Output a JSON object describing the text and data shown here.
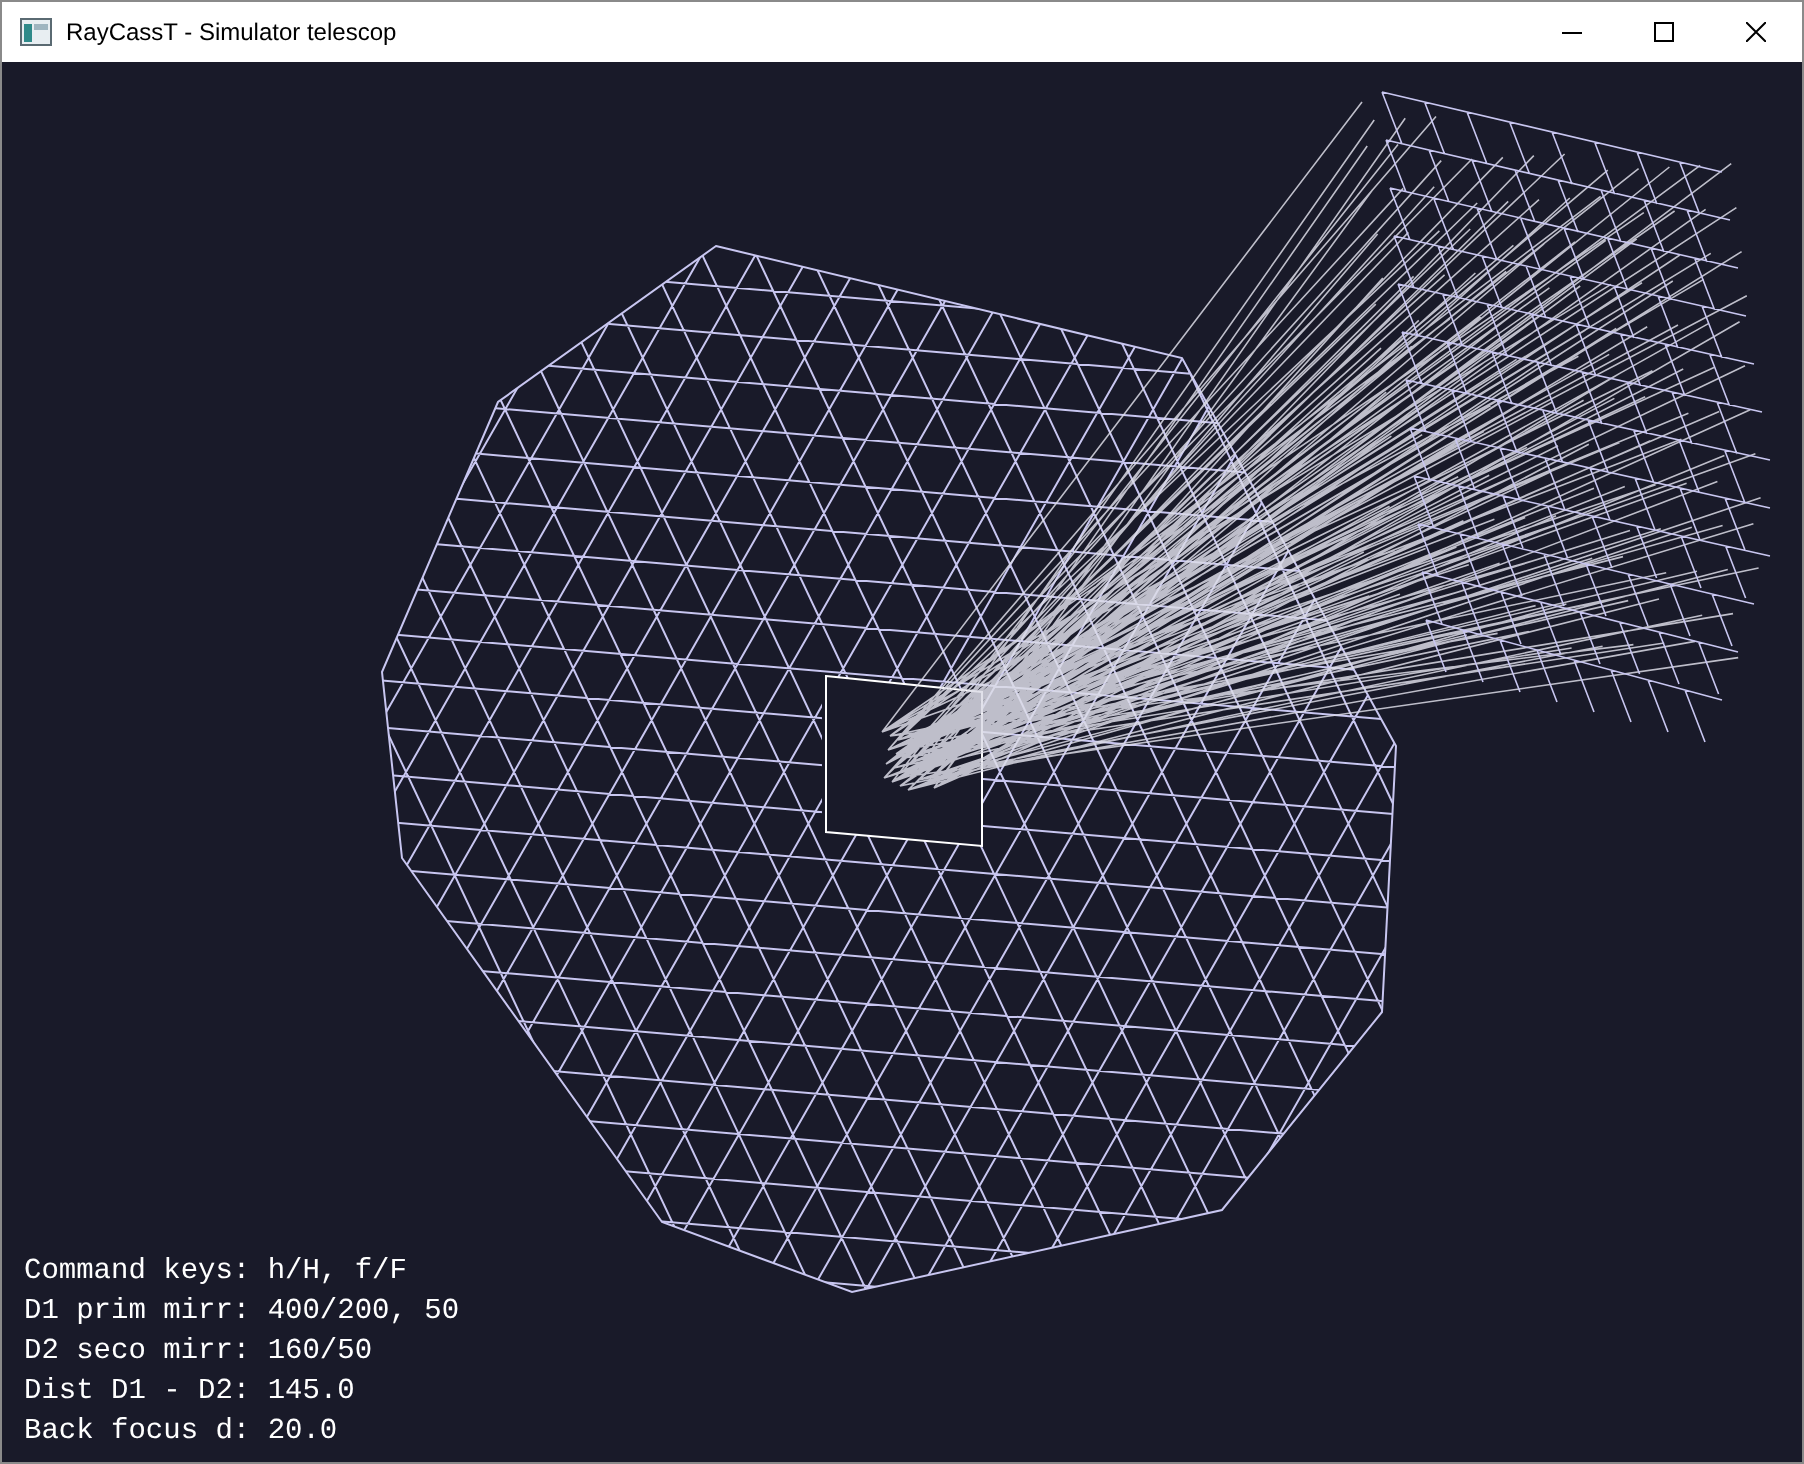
{
  "window": {
    "title": "RayCassT - Simulator telescop"
  },
  "info_lines": [
    "Command keys: h/H, f/F",
    "D1 prim mirr: 400/200, 50",
    "D2 seco mirr: 160/50",
    "Dist D1 - D2: 145.0",
    "Back focus d: 20.0"
  ]
}
